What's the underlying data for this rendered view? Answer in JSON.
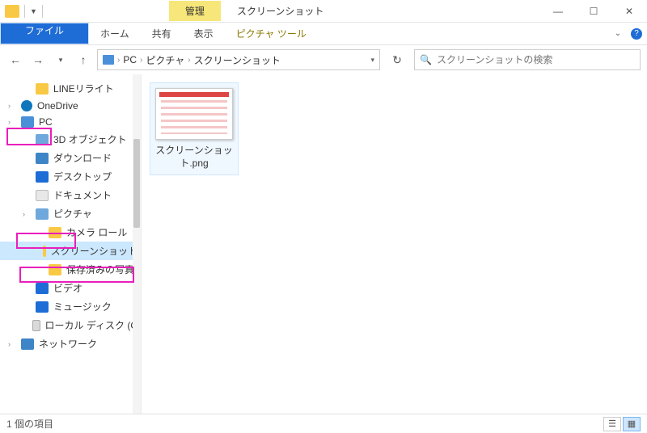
{
  "window": {
    "title": "スクリーンショット",
    "context_tab": "管理"
  },
  "ribbon": {
    "file": "ファイル",
    "home": "ホーム",
    "share": "共有",
    "view": "表示",
    "picture_tools": "ピクチャ ツール"
  },
  "breadcrumb": {
    "items": [
      "PC",
      "ピクチャ",
      "スクリーンショット"
    ]
  },
  "search": {
    "placeholder": "スクリーンショットの検索"
  },
  "tree": {
    "items": [
      {
        "label": "LINEリライト",
        "level": 1,
        "icon": "folder"
      },
      {
        "label": "OneDrive",
        "level": 0,
        "icon": "onedrive",
        "chev": true
      },
      {
        "label": "PC",
        "level": 0,
        "icon": "pc",
        "chev": true
      },
      {
        "label": "3D オブジェクト",
        "level": 1,
        "icon": "obj"
      },
      {
        "label": "ダウンロード",
        "level": 1,
        "icon": "dl"
      },
      {
        "label": "デスクトップ",
        "level": 1,
        "icon": "desk"
      },
      {
        "label": "ドキュメント",
        "level": 1,
        "icon": "doc"
      },
      {
        "label": "ピクチャ",
        "level": 1,
        "icon": "pic",
        "chev": true
      },
      {
        "label": "カメラ ロール",
        "level": 2,
        "icon": "folder"
      },
      {
        "label": "スクリーンショット",
        "level": 2,
        "icon": "folder",
        "selected": true
      },
      {
        "label": "保存済みの写真",
        "level": 2,
        "icon": "folder"
      },
      {
        "label": "ビデオ",
        "level": 1,
        "icon": "vid"
      },
      {
        "label": "ミュージック",
        "level": 1,
        "icon": "mus"
      },
      {
        "label": "ローカル ディスク (C",
        "level": 1,
        "icon": "disk"
      },
      {
        "label": "ネットワーク",
        "level": 0,
        "icon": "net",
        "chev": true
      }
    ]
  },
  "files": [
    {
      "name": "スクリーンショット.png"
    }
  ],
  "status": {
    "count_text": "1 個の項目"
  }
}
